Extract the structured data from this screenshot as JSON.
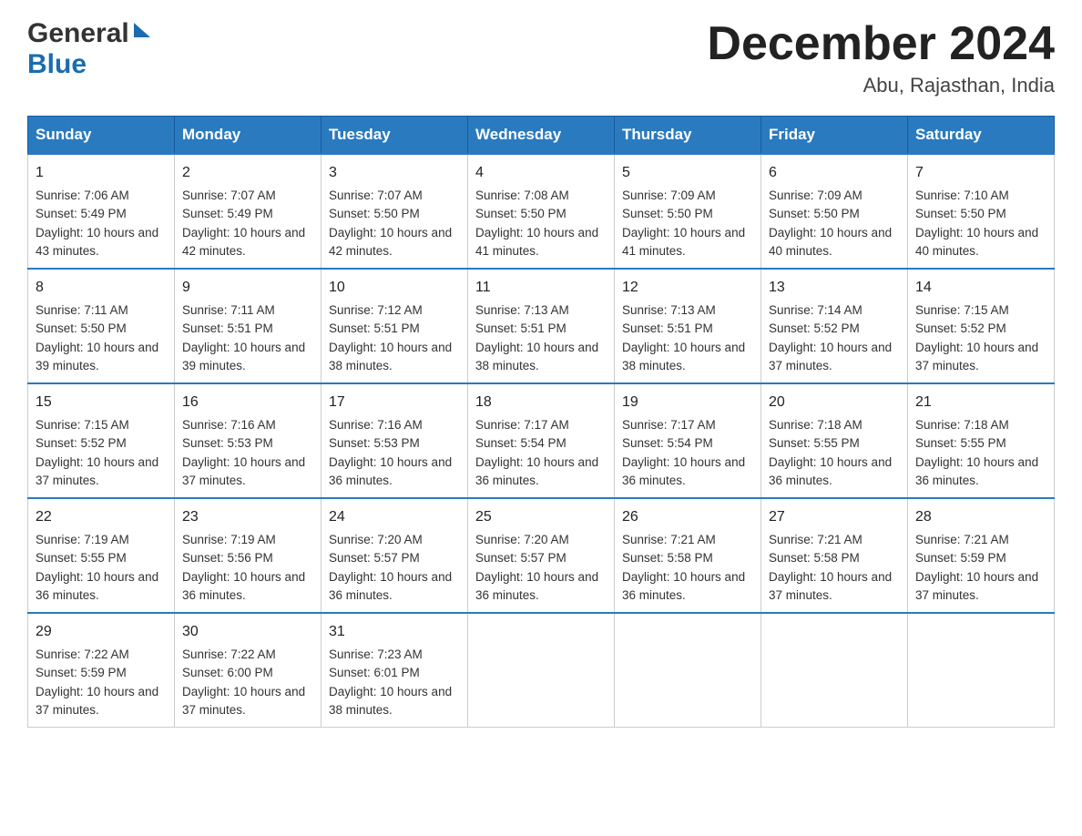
{
  "header": {
    "logo_general": "General",
    "logo_blue": "Blue",
    "month_year": "December 2024",
    "location": "Abu, Rajasthan, India"
  },
  "days_of_week": [
    "Sunday",
    "Monday",
    "Tuesday",
    "Wednesday",
    "Thursday",
    "Friday",
    "Saturday"
  ],
  "weeks": [
    [
      {
        "day": "1",
        "sunrise": "7:06 AM",
        "sunset": "5:49 PM",
        "daylight": "10 hours and 43 minutes."
      },
      {
        "day": "2",
        "sunrise": "7:07 AM",
        "sunset": "5:49 PM",
        "daylight": "10 hours and 42 minutes."
      },
      {
        "day": "3",
        "sunrise": "7:07 AM",
        "sunset": "5:50 PM",
        "daylight": "10 hours and 42 minutes."
      },
      {
        "day": "4",
        "sunrise": "7:08 AM",
        "sunset": "5:50 PM",
        "daylight": "10 hours and 41 minutes."
      },
      {
        "day": "5",
        "sunrise": "7:09 AM",
        "sunset": "5:50 PM",
        "daylight": "10 hours and 41 minutes."
      },
      {
        "day": "6",
        "sunrise": "7:09 AM",
        "sunset": "5:50 PM",
        "daylight": "10 hours and 40 minutes."
      },
      {
        "day": "7",
        "sunrise": "7:10 AM",
        "sunset": "5:50 PM",
        "daylight": "10 hours and 40 minutes."
      }
    ],
    [
      {
        "day": "8",
        "sunrise": "7:11 AM",
        "sunset": "5:50 PM",
        "daylight": "10 hours and 39 minutes."
      },
      {
        "day": "9",
        "sunrise": "7:11 AM",
        "sunset": "5:51 PM",
        "daylight": "10 hours and 39 minutes."
      },
      {
        "day": "10",
        "sunrise": "7:12 AM",
        "sunset": "5:51 PM",
        "daylight": "10 hours and 38 minutes."
      },
      {
        "day": "11",
        "sunrise": "7:13 AM",
        "sunset": "5:51 PM",
        "daylight": "10 hours and 38 minutes."
      },
      {
        "day": "12",
        "sunrise": "7:13 AM",
        "sunset": "5:51 PM",
        "daylight": "10 hours and 38 minutes."
      },
      {
        "day": "13",
        "sunrise": "7:14 AM",
        "sunset": "5:52 PM",
        "daylight": "10 hours and 37 minutes."
      },
      {
        "day": "14",
        "sunrise": "7:15 AM",
        "sunset": "5:52 PM",
        "daylight": "10 hours and 37 minutes."
      }
    ],
    [
      {
        "day": "15",
        "sunrise": "7:15 AM",
        "sunset": "5:52 PM",
        "daylight": "10 hours and 37 minutes."
      },
      {
        "day": "16",
        "sunrise": "7:16 AM",
        "sunset": "5:53 PM",
        "daylight": "10 hours and 37 minutes."
      },
      {
        "day": "17",
        "sunrise": "7:16 AM",
        "sunset": "5:53 PM",
        "daylight": "10 hours and 36 minutes."
      },
      {
        "day": "18",
        "sunrise": "7:17 AM",
        "sunset": "5:54 PM",
        "daylight": "10 hours and 36 minutes."
      },
      {
        "day": "19",
        "sunrise": "7:17 AM",
        "sunset": "5:54 PM",
        "daylight": "10 hours and 36 minutes."
      },
      {
        "day": "20",
        "sunrise": "7:18 AM",
        "sunset": "5:55 PM",
        "daylight": "10 hours and 36 minutes."
      },
      {
        "day": "21",
        "sunrise": "7:18 AM",
        "sunset": "5:55 PM",
        "daylight": "10 hours and 36 minutes."
      }
    ],
    [
      {
        "day": "22",
        "sunrise": "7:19 AM",
        "sunset": "5:55 PM",
        "daylight": "10 hours and 36 minutes."
      },
      {
        "day": "23",
        "sunrise": "7:19 AM",
        "sunset": "5:56 PM",
        "daylight": "10 hours and 36 minutes."
      },
      {
        "day": "24",
        "sunrise": "7:20 AM",
        "sunset": "5:57 PM",
        "daylight": "10 hours and 36 minutes."
      },
      {
        "day": "25",
        "sunrise": "7:20 AM",
        "sunset": "5:57 PM",
        "daylight": "10 hours and 36 minutes."
      },
      {
        "day": "26",
        "sunrise": "7:21 AM",
        "sunset": "5:58 PM",
        "daylight": "10 hours and 36 minutes."
      },
      {
        "day": "27",
        "sunrise": "7:21 AM",
        "sunset": "5:58 PM",
        "daylight": "10 hours and 37 minutes."
      },
      {
        "day": "28",
        "sunrise": "7:21 AM",
        "sunset": "5:59 PM",
        "daylight": "10 hours and 37 minutes."
      }
    ],
    [
      {
        "day": "29",
        "sunrise": "7:22 AM",
        "sunset": "5:59 PM",
        "daylight": "10 hours and 37 minutes."
      },
      {
        "day": "30",
        "sunrise": "7:22 AM",
        "sunset": "6:00 PM",
        "daylight": "10 hours and 37 minutes."
      },
      {
        "day": "31",
        "sunrise": "7:23 AM",
        "sunset": "6:01 PM",
        "daylight": "10 hours and 38 minutes."
      },
      null,
      null,
      null,
      null
    ]
  ],
  "labels": {
    "sunrise": "Sunrise:",
    "sunset": "Sunset:",
    "daylight": "Daylight:"
  }
}
